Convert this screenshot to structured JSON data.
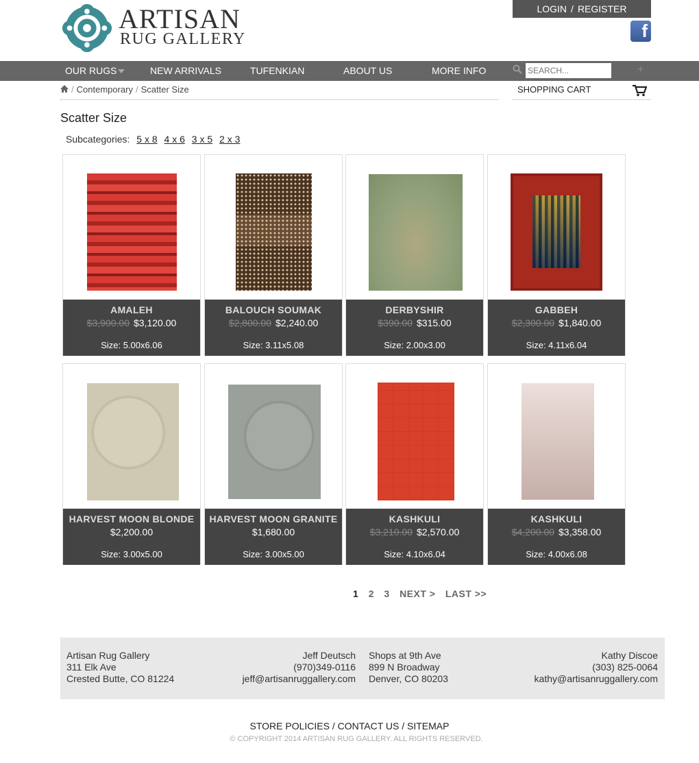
{
  "header": {
    "logo_artisan": "ARTISAN",
    "logo_sub": "RUG GALLERY",
    "login": "LOGIN",
    "separator": "/",
    "register": "REGISTER",
    "facebook_glyph": "f"
  },
  "nav": {
    "items": [
      {
        "label": "OUR RUGS"
      },
      {
        "label": "NEW ARRIVALS"
      },
      {
        "label": "TUFENKIAN"
      },
      {
        "label": "ABOUT US"
      },
      {
        "label": "MORE INFO"
      }
    ],
    "search_placeholder": "SEARCH...",
    "plus_glyph": "+"
  },
  "breadcrumb": {
    "sep": "/",
    "crumb1": "Contemporary",
    "crumb2": "Scatter Size"
  },
  "cart": {
    "label": "SHOPPING CART"
  },
  "page": {
    "title": "Scatter Size",
    "subcategories_label": "Subcategories:",
    "subcategories": [
      "5 x 8",
      "4 x 6",
      "3 x 5",
      "2 x 3"
    ]
  },
  "products": [
    {
      "name": "AMALEH",
      "old_price": "$3,900.00",
      "price": "$3,120.00",
      "size": "Size: 5.00x6.06",
      "colors": [
        "#c9302c",
        "#8e1c1c"
      ]
    },
    {
      "name": "BALOUCH SOUMAK",
      "old_price": "$2,800.00",
      "price": "$2,240.00",
      "size": "Size: 3.11x5.08",
      "colors": [
        "#5a3e2b",
        "#d9c7a0"
      ]
    },
    {
      "name": "DERBYSHIR",
      "old_price": "$390.00",
      "price": "$315.00",
      "size": "Size: 2.00x3.00",
      "colors": [
        "#8fa07a",
        "#a8a57e"
      ]
    },
    {
      "name": "GABBEH",
      "old_price": "$2,300.00",
      "price": "$1,840.00",
      "size": "Size: 4.11x6.04",
      "colors": [
        "#a8291e",
        "#3d5a80"
      ]
    },
    {
      "name": "HARVEST MOON BLONDE",
      "old_price": "",
      "price": "$2,200.00",
      "size": "Size: 3.00x5.00",
      "colors": [
        "#cfc8b2",
        "#b8b09a"
      ]
    },
    {
      "name": "HARVEST MOON GRANITE",
      "old_price": "",
      "price": "$1,680.00",
      "size": "Size: 3.00x5.00",
      "colors": [
        "#9aa09a",
        "#858b86"
      ]
    },
    {
      "name": "KASHKULI",
      "old_price": "$3,210.00",
      "price": "$2,570.00",
      "size": "Size: 4.10x6.04",
      "colors": [
        "#d8402a",
        "#c13620"
      ]
    },
    {
      "name": "KASHKULI",
      "old_price": "$4,200.00",
      "price": "$3,358.00",
      "size": "Size: 4.00x6.08",
      "colors": [
        "#e6d6d2",
        "#c9b3ad"
      ]
    }
  ],
  "pagination": {
    "pages": [
      "1",
      "2",
      "3"
    ],
    "next": "NEXT >",
    "last": "LAST >>"
  },
  "footer": {
    "col1": [
      "Artisan Rug Gallery",
      "311 Elk Ave",
      "Crested Butte, CO 81224"
    ],
    "col2": [
      "Jeff Deutsch",
      "(970)349-0116",
      "jeff@artisanruggallery.com"
    ],
    "col3": [
      "Shops at 9th Ave",
      "899 N Broadway",
      "Denver, CO 80203"
    ],
    "col4": [
      "Kathy Discoe",
      "(303) 825-0064",
      "kathy@artisanruggallery.com"
    ],
    "links": [
      "STORE POLICIES",
      "CONTACT US",
      "SITEMAP"
    ],
    "link_sep": "/",
    "copyright": "© COPYRIGHT 2014 ARTISAN RUG GALLERY. ALL RIGHTS RESERVED."
  }
}
